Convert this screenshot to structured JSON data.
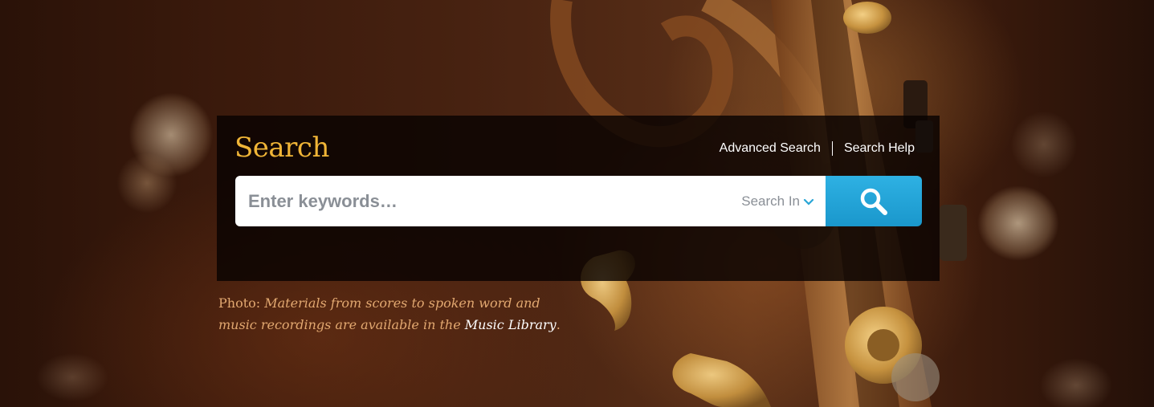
{
  "search": {
    "title": "Search",
    "advanced_link": "Advanced Search",
    "help_link": "Search Help",
    "placeholder": "Enter keywords…",
    "search_in_label": "Search In",
    "button_icon": "magnifier-icon",
    "accent_color": "#f0b537",
    "button_color": "#23a6da"
  },
  "caption": {
    "prefix": "Photo: ",
    "text": "Materials from scores to spoken word and music recordings are available in the ",
    "link": "Music Library",
    "suffix": "."
  }
}
